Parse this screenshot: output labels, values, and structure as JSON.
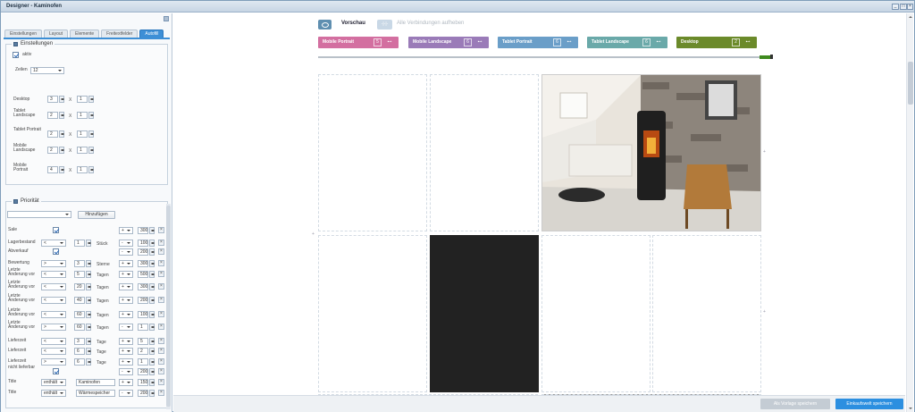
{
  "window": {
    "title": "Designer - Kaminofen"
  },
  "tabs": [
    "Einstellungen",
    "Layout",
    "Elemente",
    "Freitextfelder",
    "Autofill"
  ],
  "einstellungen": {
    "legend": "Einstellungen",
    "aktiv_label": "aktiv",
    "zeilen_label": "Zeilen",
    "zeilen_value": "12",
    "x": "X",
    "devices": [
      {
        "label": "Desktop",
        "a": "3",
        "b": "1"
      },
      {
        "label": "Tablet Landscape",
        "a": "2",
        "b": "1"
      },
      {
        "label": "Tablet Portrait",
        "a": "2",
        "b": "1"
      },
      {
        "label": "Mobile Landscape",
        "a": "2",
        "b": "1"
      },
      {
        "label": "Mobile Portrait",
        "a": "4",
        "b": "1"
      }
    ]
  },
  "prioritat": {
    "legend": "Priorität",
    "add_label": "Hinzufügen",
    "rows": [
      {
        "label": "Sale",
        "check": true,
        "op": "",
        "val": "",
        "unit": "",
        "sign": "+",
        "score": "300"
      },
      {
        "label": "Lagerbestand",
        "check": false,
        "op": "<",
        "val": "1",
        "unit": "Stück",
        "sign": "-",
        "score": "100"
      },
      {
        "label": "Abverkauf",
        "check": true,
        "op": "",
        "val": "",
        "unit": "",
        "sign": "-",
        "score": "200"
      },
      {
        "label": "Bewertung",
        "check": false,
        "op": ">",
        "val": "3",
        "unit": "Sterne",
        "sign": "+",
        "score": "300"
      },
      {
        "label": "Letzte Änderung vor",
        "check": false,
        "op": "<",
        "val": "5",
        "unit": "Tagen",
        "sign": "+",
        "score": "500"
      },
      {
        "label": "Letzte Änderung vor",
        "check": false,
        "op": "<",
        "val": "20",
        "unit": "Tagen",
        "sign": "+",
        "score": "300"
      },
      {
        "label": "Letzte Änderung vor",
        "check": false,
        "op": "<",
        "val": "40",
        "unit": "Tagen",
        "sign": "+",
        "score": "200"
      },
      {
        "label": "Letzte Änderung vor",
        "check": false,
        "op": "<",
        "val": "60",
        "unit": "Tagen",
        "sign": "+",
        "score": "100"
      },
      {
        "label": "Letzte Änderung vor",
        "check": false,
        "op": ">",
        "val": "60",
        "unit": "Tagen",
        "sign": "-",
        "score": "1"
      },
      {
        "label": "Lieferzeit",
        "check": false,
        "op": "<",
        "val": "3",
        "unit": "Tage",
        "sign": "+",
        "score": "5"
      },
      {
        "label": "Lieferzeit",
        "check": false,
        "op": "<",
        "val": "6",
        "unit": "Tage",
        "sign": "+",
        "score": "2"
      },
      {
        "label": "Lieferzeit",
        "check": false,
        "op": ">",
        "val": "6",
        "unit": "Tage",
        "sign": "+",
        "score": "1"
      },
      {
        "label": "nicht lieferbar",
        "check": true,
        "op": "",
        "val": "",
        "unit": "",
        "sign": "-",
        "score": "200"
      },
      {
        "label": "Title",
        "check": false,
        "op": "enthält",
        "val": "Kaminofen",
        "unit": "",
        "sign": "+",
        "score": "150"
      },
      {
        "label": "Title",
        "check": false,
        "op": "enthält",
        "val": "Wärmespeicher",
        "unit": "",
        "sign": "-",
        "score": "200"
      }
    ]
  },
  "toolbar": {
    "preview_label": "Vorschau",
    "unlink_label": "Alle Verbindungen aufheben",
    "unlink_icon": "-|-|-"
  },
  "breakpoints": [
    {
      "label": "Mobile Portrait",
      "count": "5",
      "color": "#d36fa0"
    },
    {
      "label": "Mobile Landscape",
      "count": "6",
      "color": "#9a7bb8"
    },
    {
      "label": "Tablet Portrait",
      "count": "6",
      "color": "#6a9ec8"
    },
    {
      "label": "Tablet Landscape",
      "count": "6",
      "color": "#6aa9a9"
    },
    {
      "label": "Desktop",
      "count": "2",
      "color": "#6b8a2a"
    }
  ],
  "footer": {
    "save_template": "Als Vorlage speichern",
    "save_world": "Einkaufswelt speichern"
  }
}
